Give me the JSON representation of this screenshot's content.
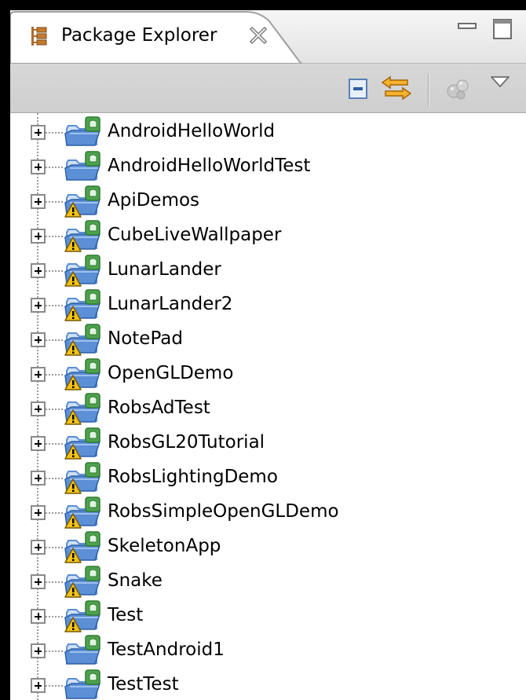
{
  "view": {
    "title": "Package Explorer"
  },
  "toolbar": {
    "collapse_all": "collapse-all-icon",
    "link_with_editor": "link-with-editor-icon",
    "filters": "filters-icon",
    "view_menu": "view-menu-icon"
  },
  "projects": [
    {
      "name": "AndroidHelloWorld",
      "warning": false
    },
    {
      "name": "AndroidHelloWorldTest",
      "warning": false
    },
    {
      "name": "ApiDemos",
      "warning": true
    },
    {
      "name": "CubeLiveWallpaper",
      "warning": true
    },
    {
      "name": "LunarLander",
      "warning": true
    },
    {
      "name": "LunarLander2",
      "warning": true
    },
    {
      "name": "NotePad",
      "warning": true
    },
    {
      "name": "OpenGLDemo",
      "warning": true
    },
    {
      "name": "RobsAdTest",
      "warning": true
    },
    {
      "name": "RobsGL20Tutorial",
      "warning": true
    },
    {
      "name": "RobsLightingDemo",
      "warning": true
    },
    {
      "name": "RobsSimpleOpenGLDemo",
      "warning": true
    },
    {
      "name": "SkeletonApp",
      "warning": true
    },
    {
      "name": "Snake",
      "warning": true
    },
    {
      "name": "Test",
      "warning": true
    },
    {
      "name": "TestAndroid1",
      "warning": false
    },
    {
      "name": "TestTest",
      "warning": false
    }
  ],
  "colors": {
    "folder_blue": "#5b8fd6",
    "folder_light": "#cfe0f6",
    "android_green": "#4ea24e",
    "warning_yellow": "#f2c316",
    "link_orange": "#f0a020"
  }
}
